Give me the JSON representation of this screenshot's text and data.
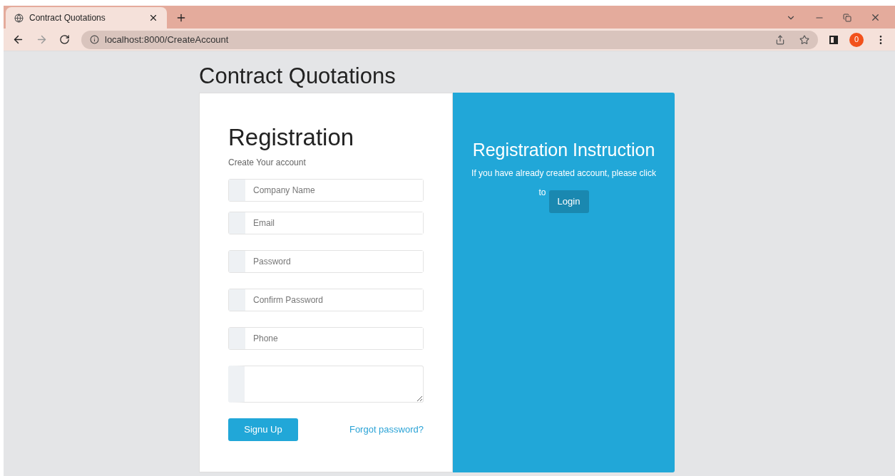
{
  "browser": {
    "tab": {
      "title": "Contract Quotations",
      "selected": true
    },
    "address": "localhost:8000/CreateAccount",
    "profile_badge": "0"
  },
  "page": {
    "title": "Contract Quotations"
  },
  "registration": {
    "heading": "Registration",
    "subtitle": "Create Your account",
    "fields": [
      {
        "kind": "input",
        "placeholder": "Company Name"
      },
      {
        "kind": "input",
        "placeholder": "Email"
      },
      {
        "kind": "input",
        "placeholder": "Password"
      },
      {
        "kind": "input",
        "placeholder": "Confirm Password"
      },
      {
        "kind": "input",
        "placeholder": "Phone"
      },
      {
        "kind": "textarea"
      }
    ],
    "submit": "Signu Up",
    "forgot_link": "Forgot password?"
  },
  "instructions": {
    "heading": "Registration Instruction",
    "text": "If you have already created account, please click",
    "prefix": "to",
    "login_button": "Login"
  }
}
